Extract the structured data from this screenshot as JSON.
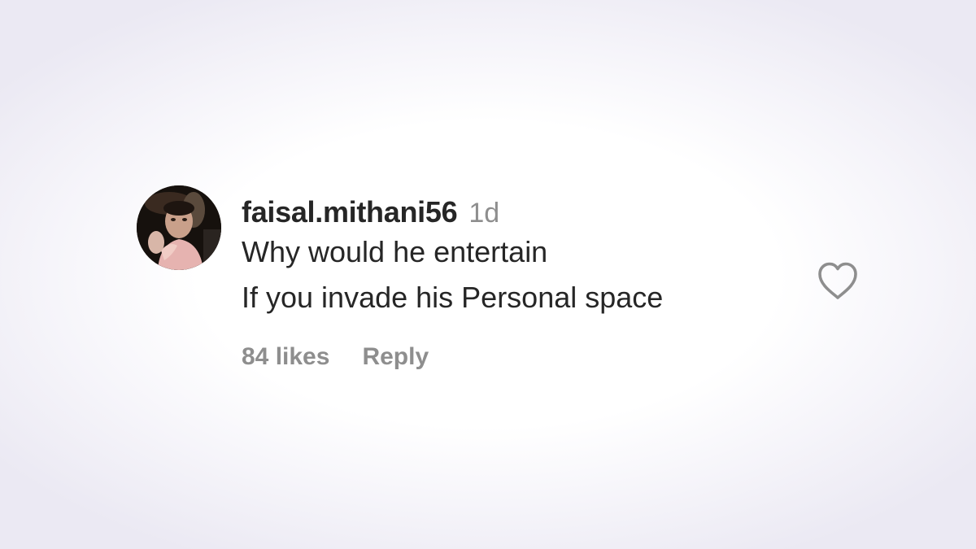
{
  "comment": {
    "username": "faisal.mithani56",
    "time": "1d",
    "text_lines": [
      "Why would he entertain",
      "If you invade his Personal space"
    ],
    "likes": "84 likes",
    "reply_label": "Reply",
    "like_icon": "heart-outline-icon",
    "avatar_icon": "profile-photo"
  },
  "colors": {
    "text_primary": "#262626",
    "text_secondary": "#8e8e8e",
    "heart_stroke": "#8e8e8e"
  }
}
